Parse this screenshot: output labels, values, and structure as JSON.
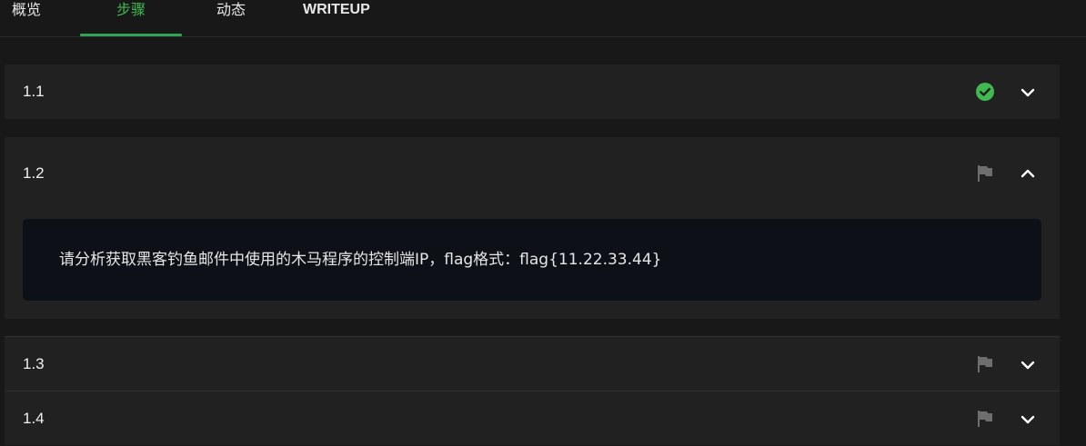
{
  "tabs": [
    {
      "label": "概览"
    },
    {
      "label": "步骤"
    },
    {
      "label": "动态"
    },
    {
      "label": "WRITEUP"
    }
  ],
  "active_tab": "步骤",
  "colors": {
    "accent": "#3fb950",
    "solved": "#3fb950",
    "flag_icon": "#6e6e6e"
  },
  "steps": [
    {
      "label": "1.1",
      "status_icon": "check-circle-icon",
      "expanded": false
    },
    {
      "label": "1.2",
      "status_icon": "flag-icon",
      "expanded": true,
      "description": "请分析获取黑客钓鱼邮件中使用的木马程序的控制端IP，flag格式：flag{11.22.33.44}"
    },
    {
      "label": "1.3",
      "status_icon": "flag-icon",
      "expanded": false
    },
    {
      "label": "1.4",
      "status_icon": "flag-icon",
      "expanded": false
    }
  ]
}
